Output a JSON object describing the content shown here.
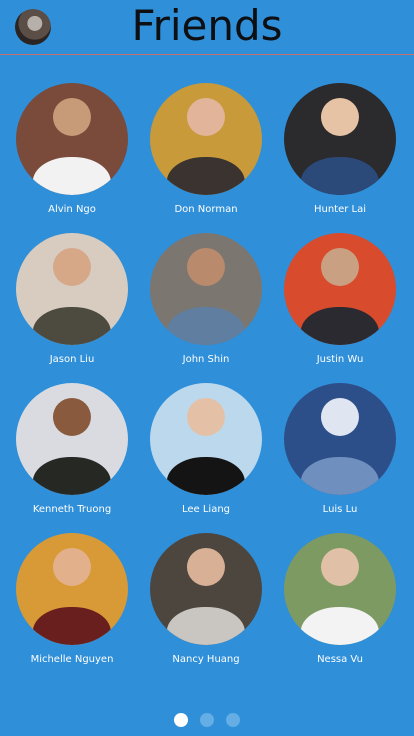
{
  "header": {
    "title": "Friends",
    "profile_icon": "user-avatar"
  },
  "friends": [
    {
      "name": "Alvin Ngo",
      "bg": "#7a4a3a",
      "head": "#c79a78",
      "body": "#f2f2f2"
    },
    {
      "name": "Don Norman",
      "bg": "#c89a3a",
      "head": "#e2b49a",
      "body": "#3a3330"
    },
    {
      "name": "Hunter Lai",
      "bg": "#2b2a2c",
      "head": "#e6c3a5",
      "body": "#2b4a7a"
    },
    {
      "name": "Jason Liu",
      "bg": "#d8ccc0",
      "head": "#d6a888",
      "body": "#4d4a3f"
    },
    {
      "name": "John Shin",
      "bg": "#7c7670",
      "head": "#b98a6c",
      "body": "#5f7ea0"
    },
    {
      "name": "Justin Wu",
      "bg": "#d84b2c",
      "head": "#caa083",
      "body": "#2a2a30"
    },
    {
      "name": "Kenneth Truong",
      "bg": "#d9dbe0",
      "head": "#8a5a3e",
      "body": "#252823"
    },
    {
      "name": "Lee Liang",
      "bg": "#bcd8ec",
      "head": "#e4c1a6",
      "body": "#141414"
    },
    {
      "name": "Luis Lu",
      "bg": "#2d4f89",
      "head": "#dfe6f2",
      "body": "#6f8fbf"
    },
    {
      "name": "Michelle Nguyen",
      "bg": "#d89a36",
      "head": "#e3b08c",
      "body": "#6a1f1f"
    },
    {
      "name": "Nancy Huang",
      "bg": "#4c463f",
      "head": "#d8b096",
      "body": "#c9c6c2"
    },
    {
      "name": "Nessa Vu",
      "bg": "#7e9a63",
      "head": "#e0c0a7",
      "body": "#f3f3f3"
    }
  ],
  "pagination": {
    "pages": 3,
    "active": 0
  },
  "colors": {
    "background": "#2f8fd9",
    "divider": "#c8706a"
  }
}
